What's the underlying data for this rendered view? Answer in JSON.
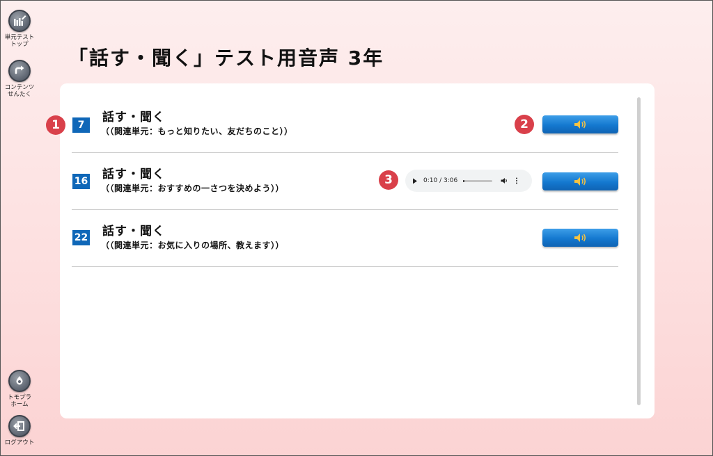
{
  "page": {
    "title": "「話す・聞く」テスト用音声 3年",
    "background": "#fde4e4",
    "accent": "#0f67b8"
  },
  "sidebar": {
    "items": [
      {
        "label": "単元テスト\nトップ",
        "icon": "unit-test-top-icon"
      },
      {
        "label": "コンテンツ\nせんたく",
        "icon": "content-select-icon"
      },
      {
        "label": "トモプラ\nホーム",
        "icon": "tomopla-home-icon"
      },
      {
        "label": "ログアウト",
        "icon": "logout-icon"
      }
    ]
  },
  "rows": [
    {
      "number": "7",
      "title": "話す・聞く",
      "subtitle": "（（関連単元：もっと知りたい、友だちのこと））",
      "button_icon": "speaker-icon"
    },
    {
      "number": "16",
      "title": "話す・聞く",
      "subtitle": "（（関連単元：おすすめの一さつを決めよう））",
      "button_icon": "speaker-icon"
    },
    {
      "number": "22",
      "title": "話す・聞く",
      "subtitle": "（（関連単元：お気に入りの場所、教えます））",
      "button_icon": "speaker-icon"
    }
  ],
  "audio_player": {
    "time": "0:10 / 3:06",
    "progress": 0.054
  },
  "markers": [
    "1",
    "2",
    "3"
  ]
}
